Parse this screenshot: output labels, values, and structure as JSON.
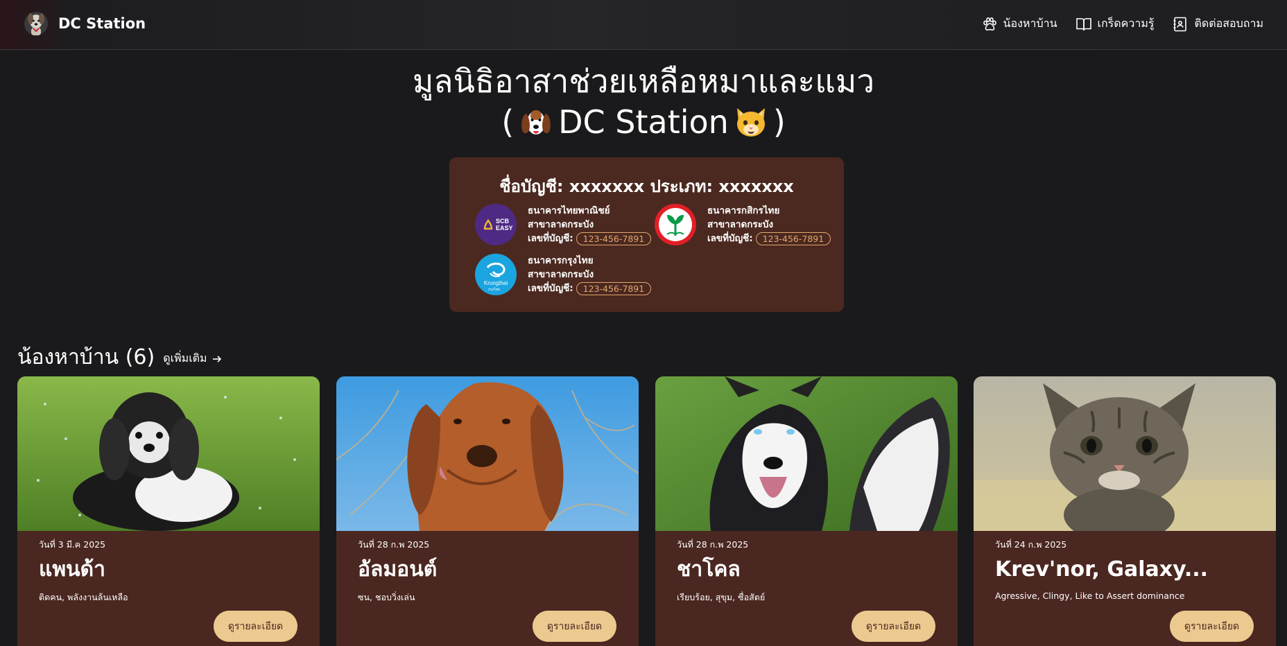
{
  "nav": {
    "brand": "DC Station",
    "links": [
      {
        "label": "น้องหาบ้าน",
        "icon": "paw-icon"
      },
      {
        "label": "เกร็ดความรู้",
        "icon": "book-icon"
      },
      {
        "label": "ติดต่อสอบถาม",
        "icon": "contact-book-icon"
      }
    ]
  },
  "hero": {
    "line1": "มูลนิธิอาสาช่วยเหลือหมาและแมว",
    "open": "(",
    "name": "DC Station",
    "close": ")"
  },
  "bank": {
    "title": "ชื่อบัญชี: xxxxxxx ประเภท: xxxxxxx",
    "account_label": "เลขที่บัญชี:",
    "items": [
      {
        "name": "ธนาคารไทยพาณิชย์",
        "branch": "สาขาลาดกระบัง",
        "account": "123-456-7891",
        "logo": "scb-logo",
        "logo_text_1": "SCB",
        "logo_text_2": "EASY",
        "color": "#4e2a84"
      },
      {
        "name": "ธนาคารกสิกรไทย",
        "branch": "สาขาลาดกระบัง",
        "account": "123-456-7891",
        "logo": "kbank-logo",
        "color": "#e21f26"
      },
      {
        "name": "ธนาคารกรุงไทย",
        "branch": "สาขาลาดกระบัง",
        "account": "123-456-7891",
        "logo": "krungthai-logo",
        "logo_text_1": "Krungthai",
        "logo_text_2": "กรุงไทย",
        "color": "#1ba5e0"
      }
    ]
  },
  "section": {
    "title": "น้องหาบ้าน (6)",
    "see_more": "ดูเพิ่มเติม"
  },
  "cards": [
    {
      "date": "วันที่ 3 มี.ค 2025",
      "name": "แพนด้า",
      "tags": "ติดคน, พลังงานล้นเหลือ",
      "button": "ดูรายละเอียด",
      "photo": "shih-tzu-photo"
    },
    {
      "date": "วันที่ 28 ก.พ 2025",
      "name": "อัลมอนต์",
      "tags": "ซน, ชอบวิ่งเล่น",
      "button": "ดูรายละเอียด",
      "photo": "bloodhound-photo"
    },
    {
      "date": "วันที่ 28 ก.พ 2025",
      "name": "ชาโคล",
      "tags": "เรียบร้อย, สุขุม, ซื่อสัตย์",
      "button": "ดูรายละเอียด",
      "photo": "husky-photo"
    },
    {
      "date": "วันที่ 24 ก.พ 2025",
      "name": "Krev'nor, Galaxy...",
      "tags": "Agressive, Clingy, Like to Assert dominance",
      "button": "ดูรายละเอียด",
      "photo": "kitten-photo"
    }
  ],
  "colors": {
    "background": "#1a1a1c",
    "panel": "#4b2920",
    "accent_button": "#ecc98f",
    "account_text": "#e2a66c"
  }
}
